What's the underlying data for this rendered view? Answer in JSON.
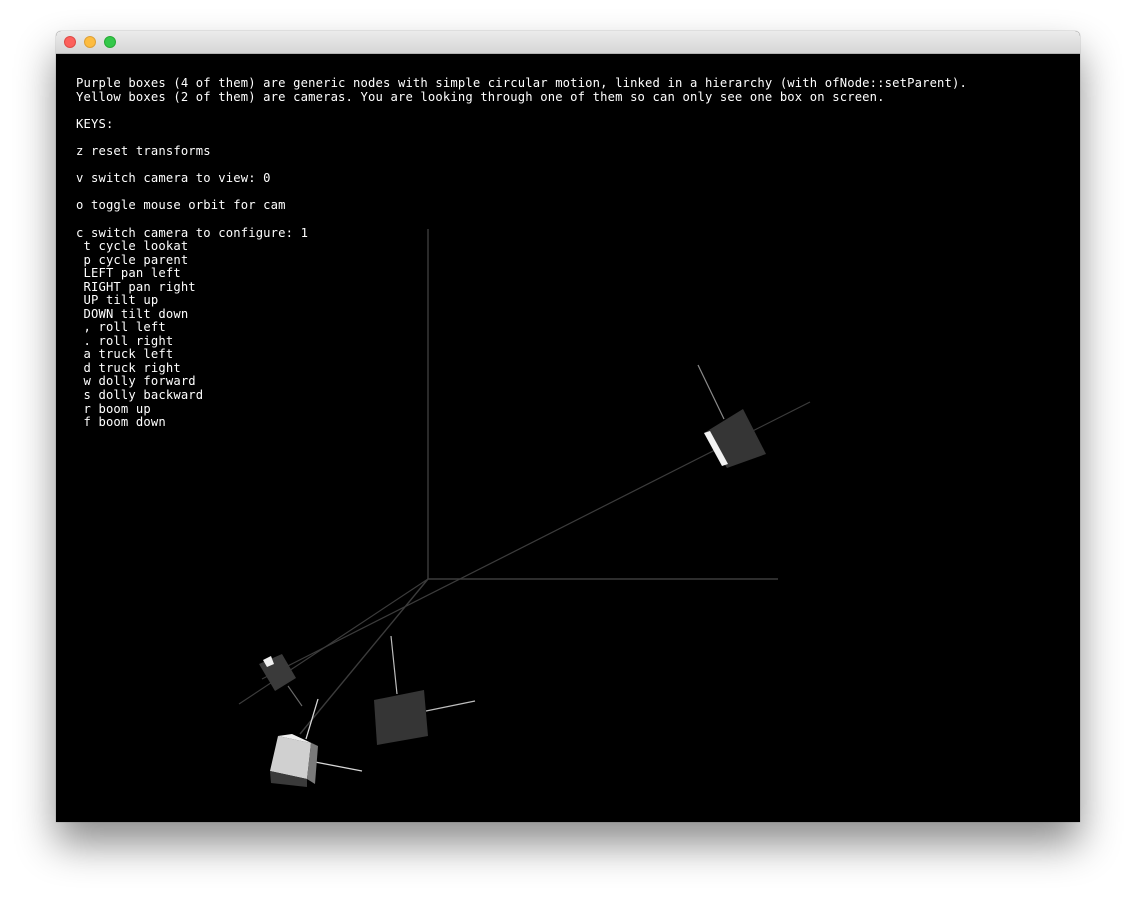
{
  "window": {
    "controls": [
      "close",
      "minimize",
      "zoom"
    ]
  },
  "info": {
    "line1": "Purple boxes (4 of them) are generic nodes with simple circular motion, linked in a hierarchy (with ofNode::setParent).",
    "line2": "Yellow boxes (2 of them) are cameras. You are looking through one of them so can only see one box on screen."
  },
  "keys": {
    "header": "KEYS:",
    "reset": "z reset transforms",
    "switch_view": "v switch camera to view: 0",
    "orbit": "o toggle mouse orbit for cam",
    "configure": "c switch camera to configure: 1",
    "sub": [
      " t cycle lookat",
      " p cycle parent",
      " LEFT pan left",
      " RIGHT pan right",
      " UP tilt up",
      " DOWN tilt down",
      " , roll left",
      " . roll right",
      " a truck left",
      " d truck right",
      " w dolly forward",
      " s dolly backward",
      " r boom up",
      " f boom down"
    ]
  }
}
